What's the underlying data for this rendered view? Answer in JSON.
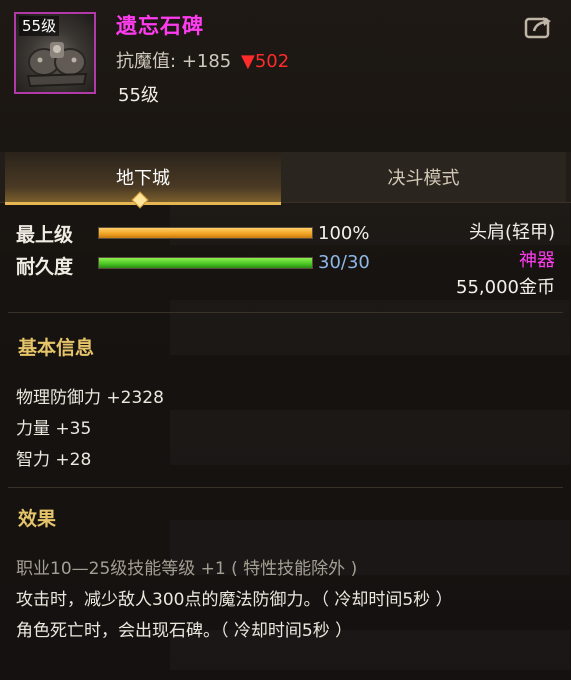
{
  "item": {
    "icon_level_badge": "55级",
    "name": "遗忘石碑",
    "resist_label": "抗魔值:",
    "resist_value": "+185",
    "resist_down_icon": "down-triangle-icon",
    "resist_down_value": "502",
    "level_text": "55级",
    "name_color": "#ff3cf0"
  },
  "header": {
    "share_icon": "share-icon"
  },
  "tabs": [
    {
      "label": "地下城",
      "active": true
    },
    {
      "label": "决斗模式",
      "active": false
    }
  ],
  "stats": {
    "max_level": {
      "label": "最上级",
      "value_text": "100%",
      "fraction": 1.0
    },
    "durability": {
      "label": "耐久度",
      "value_text": "30/30",
      "fraction": 1.0
    }
  },
  "info": {
    "slot": "头肩(轻甲)",
    "rarity": "神器",
    "rarity_color": "#ff3cf0",
    "price": "55,000金币"
  },
  "basic_info": {
    "title": "基本信息",
    "lines": [
      "物理防御力 +2328",
      "力量 +35",
      "智力 +28"
    ]
  },
  "effects": {
    "title": "效果",
    "lines": [
      "职业10—25级技能等级 +1 ( 特性技能除外 )",
      "攻击时，减少敌人300点的魔法防御力。（ 冷却时间5秒 ）",
      "角色死亡时，会出现石碑。（ 冷却时间5秒 ）"
    ]
  }
}
